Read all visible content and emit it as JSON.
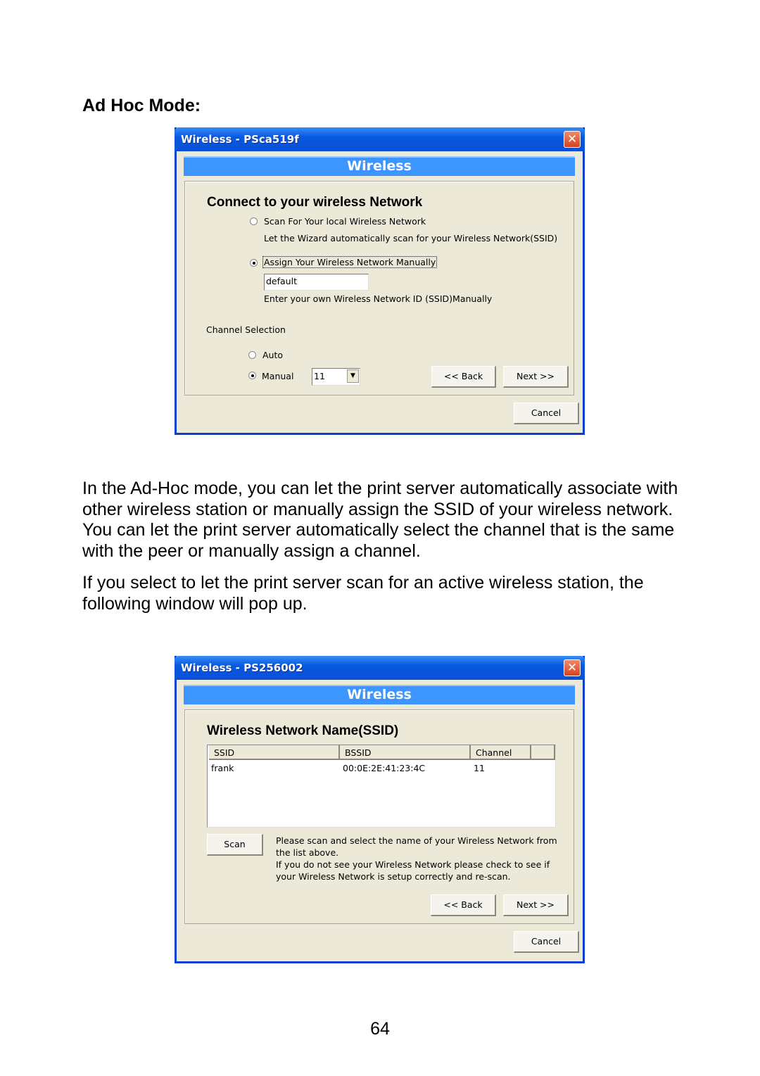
{
  "heading": "Ad Hoc Mode:",
  "paragraph1": "In the Ad-Hoc mode, you can let the print server automatically associate with other wireless station or manually assign the SSID of your wireless network. You can let the print server automatically select the channel that is the same with the peer or manually assign a channel.",
  "paragraph2": "If you select to let the print server scan for an active wireless station, the following window will pop up.",
  "page_number": "64",
  "dialog1": {
    "title": "Wireless - PSca519f",
    "band": "Wireless",
    "heading": "Connect to your wireless Network",
    "scan_option": "Scan For Your local Wireless Network",
    "scan_desc": "Let the Wizard automatically scan for your Wireless Network(SSID)",
    "manual_option": "Assign Your Wireless Network Manually",
    "ssid_value": "default",
    "manual_desc": "Enter your own Wireless Network ID (SSID)Manually",
    "channel_label": "Channel Selection",
    "auto_label": "Auto",
    "manual_label": "Manual",
    "channel_value": "11",
    "selected_ssid_mode": "manual",
    "selected_channel_mode": "manual",
    "back": "<< Back",
    "next": "Next >>",
    "cancel": "Cancel"
  },
  "dialog2": {
    "title": "Wireless - PS256002",
    "band": "Wireless",
    "heading": "Wireless Network Name(SSID)",
    "columns": [
      "SSID",
      "BSSID",
      "Channel"
    ],
    "rows": [
      {
        "ssid": "frank",
        "bssid": "00:0E:2E:41:23:4C",
        "channel": "11"
      }
    ],
    "scan": "Scan",
    "msg1": "Please scan and select the name of your Wireless Network from",
    "msg2": "the list above.",
    "msg3": "If you do not see your Wireless Network please check to see if",
    "msg4": "your Wireless Network is setup correctly and re-scan.",
    "back": "<< Back",
    "next": "Next >>",
    "cancel": "Cancel"
  }
}
